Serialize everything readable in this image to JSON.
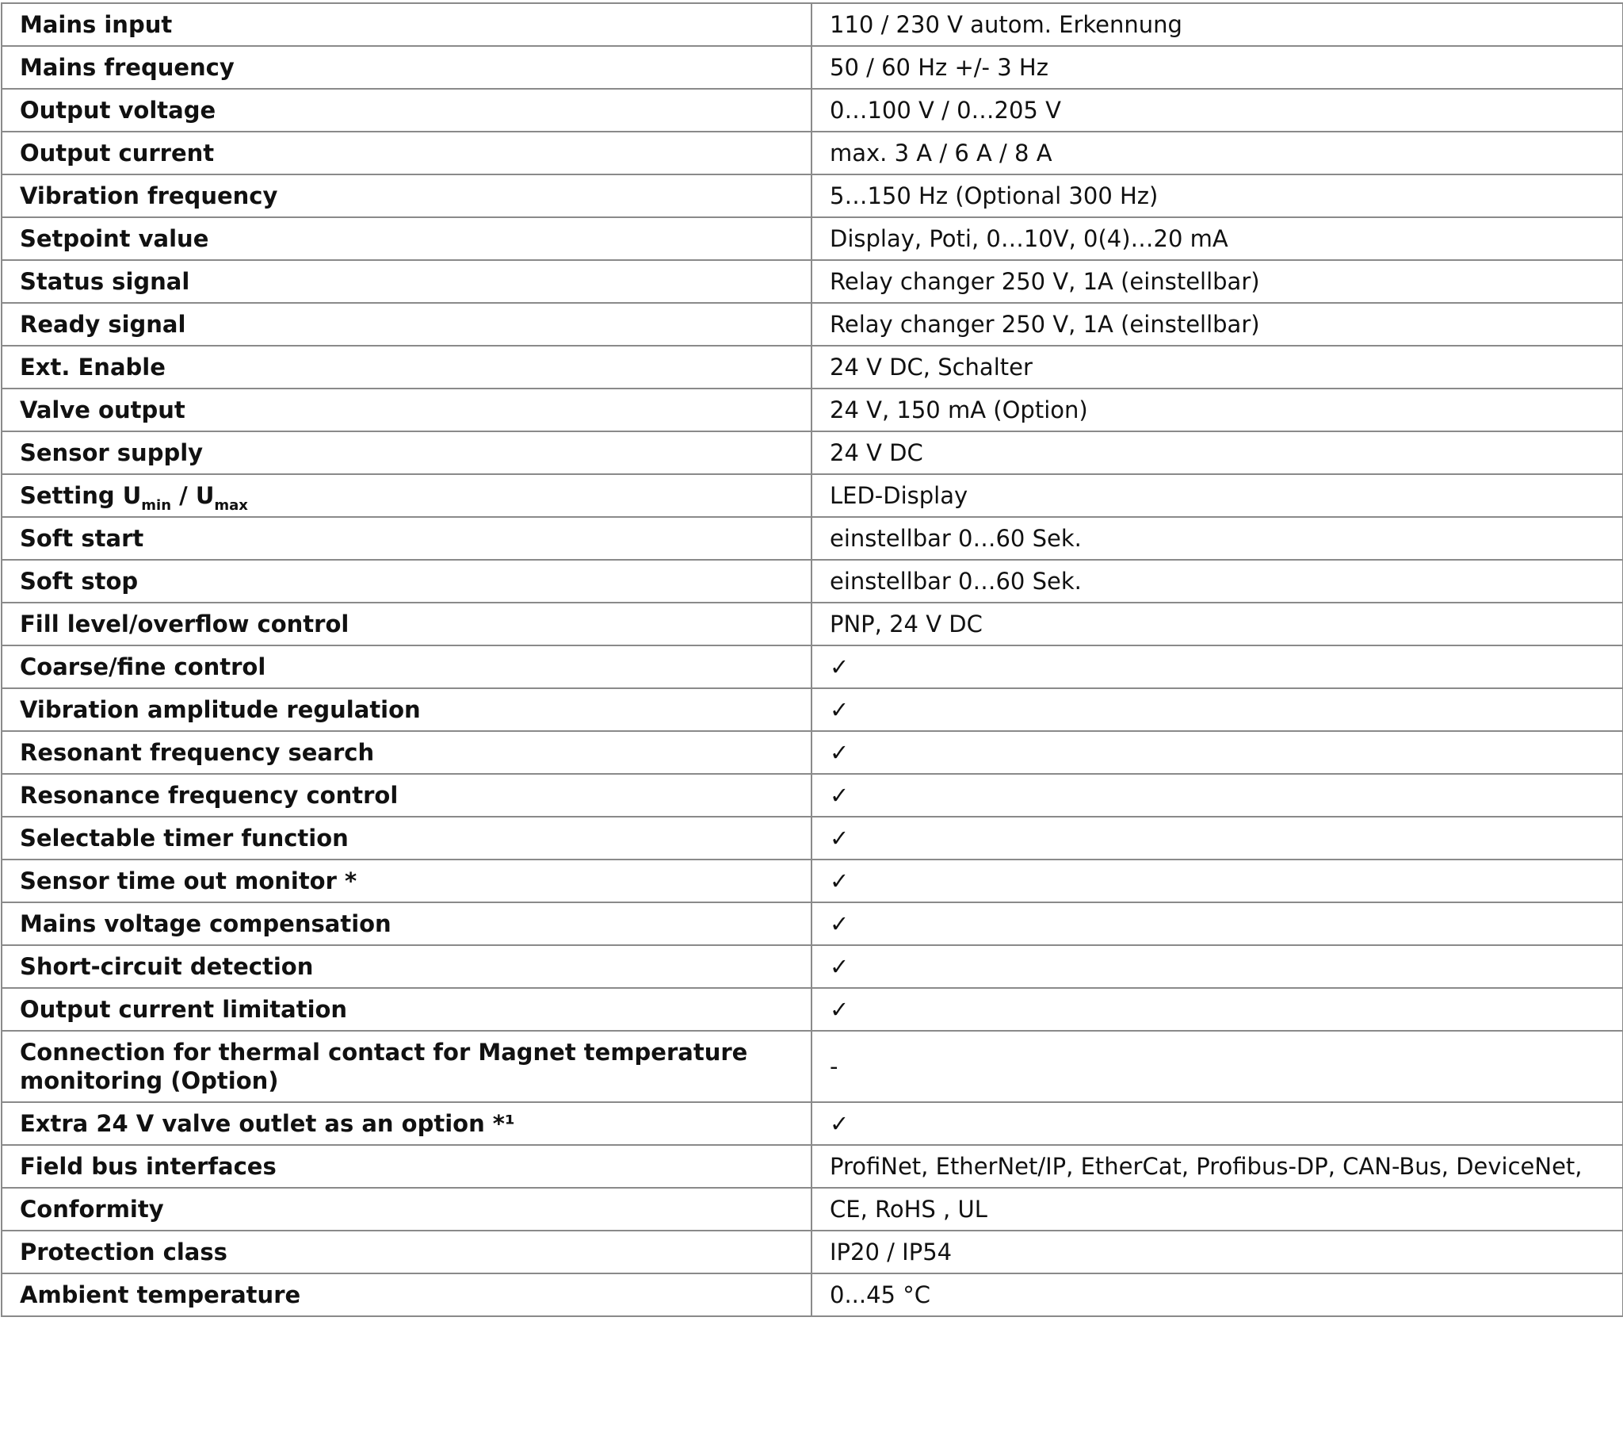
{
  "rows": [
    {
      "label": "Mains input",
      "value": "110 / 230 V autom. Erkennung"
    },
    {
      "label": "Mains frequency",
      "value": "50 / 60 Hz +/- 3 Hz"
    },
    {
      "label": "Output voltage",
      "value": "0…100 V / 0…205 V"
    },
    {
      "label": "Output current",
      "value": "max. 3 A / 6 A / 8 A"
    },
    {
      "label": "Vibration frequency",
      "value": "5…150 Hz (Optional 300 Hz)"
    },
    {
      "label": "Setpoint value",
      "value": "Display, Poti, 0…10V, 0(4)…20 mA"
    },
    {
      "label": "Status signal",
      "value": "Relay changer 250 V, 1A (einstellbar)"
    },
    {
      "label": "Ready signal",
      "value": "Relay changer 250 V, 1A (einstellbar)"
    },
    {
      "label": "Ext. Enable",
      "value": "24 V DC, Schalter"
    },
    {
      "label": "Valve output",
      "value": "24 V, 150 mA (Option)"
    },
    {
      "label": "Sensor supply",
      "value": "24 V DC"
    },
    {
      "label_parts": [
        "Setting U",
        "min",
        " / U",
        "max"
      ],
      "value": "LED-Display"
    },
    {
      "label": "Soft start",
      "value": "einstellbar 0…60 Sek."
    },
    {
      "label": "Soft stop",
      "value": "einstellbar 0…60 Sek."
    },
    {
      "label": "Fill level/overflow control",
      "value": "PNP, 24 V DC"
    },
    {
      "label": "Coarse/fine control",
      "value": "✓"
    },
    {
      "label": "Vibration amplitude regulation",
      "value": "✓"
    },
    {
      "label": "Resonant frequency search",
      "value": "✓"
    },
    {
      "label": "Resonance frequency control",
      "value": "✓"
    },
    {
      "label": "Selectable timer function",
      "value": "✓"
    },
    {
      "label": "Sensor time out monitor *",
      "value": "✓"
    },
    {
      "label": "Mains voltage compensation",
      "value": "✓"
    },
    {
      "label": "Short-circuit detection",
      "value": "✓"
    },
    {
      "label": "Output current limitation",
      "value": "✓"
    },
    {
      "label": "Connection for thermal contact for Magnet temperature monitoring (Option)",
      "value": "-"
    },
    {
      "label": "Extra 24 V valve outlet as an option *¹",
      "value": "✓"
    },
    {
      "label": "Field bus interfaces",
      "value": "ProfiNet, EtherNet/IP, EtherCat, Profibus-DP, CAN-Bus, DeviceNet,"
    },
    {
      "label": "Conformity",
      "value": "CE, RoHS , UL"
    },
    {
      "label": "Protection class",
      "value": "IP20 / IP54"
    },
    {
      "label": "Ambient temperature",
      "value": "0...45 °C"
    }
  ]
}
